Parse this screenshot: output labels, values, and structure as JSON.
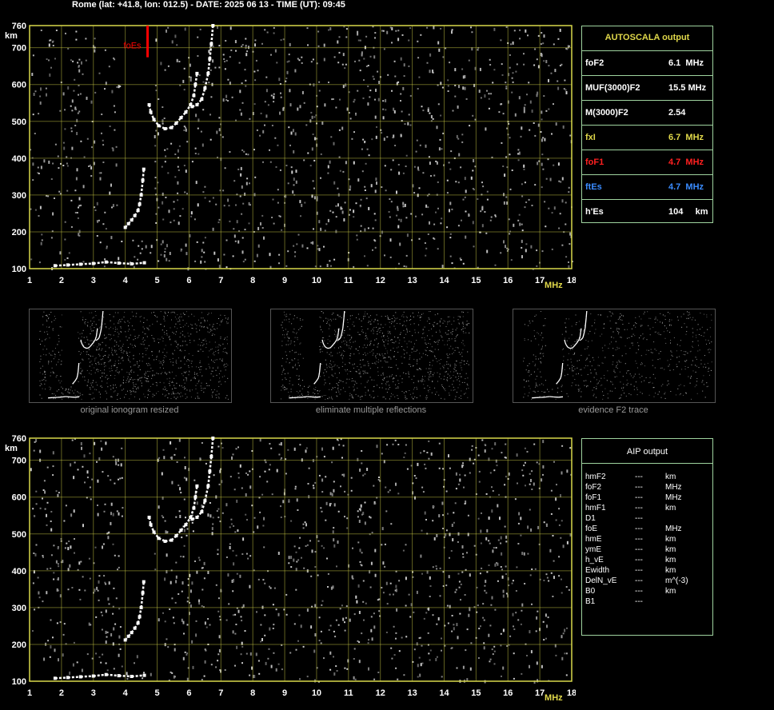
{
  "header": {
    "text": "Rome (lat: +41.8, lon: 012.5) - DATE: 2025 06 13 - TIME (UT): 09:45"
  },
  "colors": {
    "grid": "#d8d84a",
    "red": "#ff0000",
    "blue": "#3a8cff",
    "yellow": "#e0d84a",
    "tableBorder": "#9fd39f",
    "caption": "#9a9a9a"
  },
  "ionogram": {
    "y_unit": "km",
    "x_unit": "MHz",
    "y_ticks": [
      "760",
      "700",
      "600",
      "500",
      "400",
      "300",
      "200",
      "100"
    ],
    "x_ticks": [
      "1",
      "2",
      "3",
      "4",
      "5",
      "6",
      "7",
      "8",
      "9",
      "10",
      "11",
      "12",
      "13",
      "14",
      "15",
      "16",
      "17",
      "18"
    ],
    "es_label": "foEs"
  },
  "chart_data": {
    "type": "scatter",
    "xlim": [
      1,
      18
    ],
    "ylim": [
      100,
      760
    ],
    "x_scale": "linear",
    "y_scale": "linear",
    "grid": true,
    "series": [
      {
        "points": [
          [
            4.0,
            212
          ],
          [
            4.1,
            222
          ],
          [
            4.2,
            232
          ],
          [
            4.3,
            244
          ],
          [
            4.4,
            258
          ],
          [
            4.45,
            275
          ],
          [
            4.5,
            300
          ],
          [
            4.55,
            340
          ],
          [
            4.58,
            370
          ]
        ]
      },
      {
        "points": [
          [
            4.75,
            545
          ],
          [
            4.8,
            525
          ],
          [
            4.9,
            505
          ],
          [
            5.05,
            488
          ],
          [
            5.25,
            480
          ],
          [
            5.45,
            483
          ],
          [
            5.6,
            495
          ],
          [
            5.75,
            510
          ],
          [
            5.9,
            525
          ],
          [
            6.05,
            545
          ],
          [
            6.15,
            570
          ],
          [
            6.2,
            600
          ],
          [
            6.25,
            630
          ]
        ]
      },
      {
        "points": [
          [
            6.1,
            540
          ],
          [
            6.25,
            545
          ],
          [
            6.4,
            560
          ],
          [
            6.5,
            590
          ],
          [
            6.6,
            630
          ],
          [
            6.65,
            670
          ],
          [
            6.7,
            710
          ],
          [
            6.75,
            760
          ]
        ]
      },
      {
        "points": [
          [
            1.8,
            108
          ],
          [
            2.2,
            110
          ],
          [
            2.6,
            112
          ],
          [
            3.0,
            114
          ],
          [
            3.4,
            118
          ],
          [
            3.8,
            115
          ],
          [
            4.2,
            113
          ],
          [
            4.6,
            116
          ]
        ]
      }
    ],
    "foEs_marker": {
      "x": 4.7,
      "ymin": 700,
      "ymax": 760
    }
  },
  "autoscala": {
    "title": "AUTOSCALA output",
    "rows": [
      {
        "k": "foF2",
        "v": "6.1  MHz",
        "c": "#ffffff"
      },
      {
        "k": "MUF(3000)F2",
        "v": "15.5 MHz",
        "c": "#ffffff"
      },
      {
        "k": "M(3000)F2",
        "v": "2.54",
        "c": "#ffffff"
      },
      {
        "k": "fxI",
        "v": "6.7  MHz",
        "c": "#e0d84a"
      },
      {
        "k": "foF1",
        "v": "4.7  MHz",
        "c": "#ff2020"
      },
      {
        "k": "ftEs",
        "v": "4.7  MHz",
        "c": "#3a8cff"
      },
      {
        "k": "h'Es",
        "v": "104     km",
        "c": "#ffffff"
      }
    ]
  },
  "thumbs": [
    {
      "caption": "original ionogram resized"
    },
    {
      "caption": "eliminate multiple reflections"
    },
    {
      "caption": "evidence F2 trace"
    }
  ],
  "aip": {
    "title": "AIP output",
    "rows": [
      {
        "k": "hmF2",
        "d": "---",
        "u": "km"
      },
      {
        "k": "foF2",
        "d": "---",
        "u": "MHz"
      },
      {
        "k": "foF1",
        "d": "---",
        "u": "MHz"
      },
      {
        "k": "hmF1",
        "d": "---",
        "u": "km"
      },
      {
        "k": "D1",
        "d": "---",
        "u": ""
      },
      {
        "k": "foE",
        "d": "---",
        "u": "MHz"
      },
      {
        "k": "hmE",
        "d": "---",
        "u": "km"
      },
      {
        "k": "ymE",
        "d": "---",
        "u": "km"
      },
      {
        "k": "h_vE",
        "d": "---",
        "u": "km"
      },
      {
        "k": "Ewidth",
        "d": "---",
        "u": "km"
      },
      {
        "k": "DelN_vE",
        "d": "---",
        "u": "m^(-3)"
      },
      {
        "k": "B0",
        "d": "---",
        "u": "km"
      },
      {
        "k": "B1",
        "d": "---",
        "u": ""
      }
    ]
  }
}
